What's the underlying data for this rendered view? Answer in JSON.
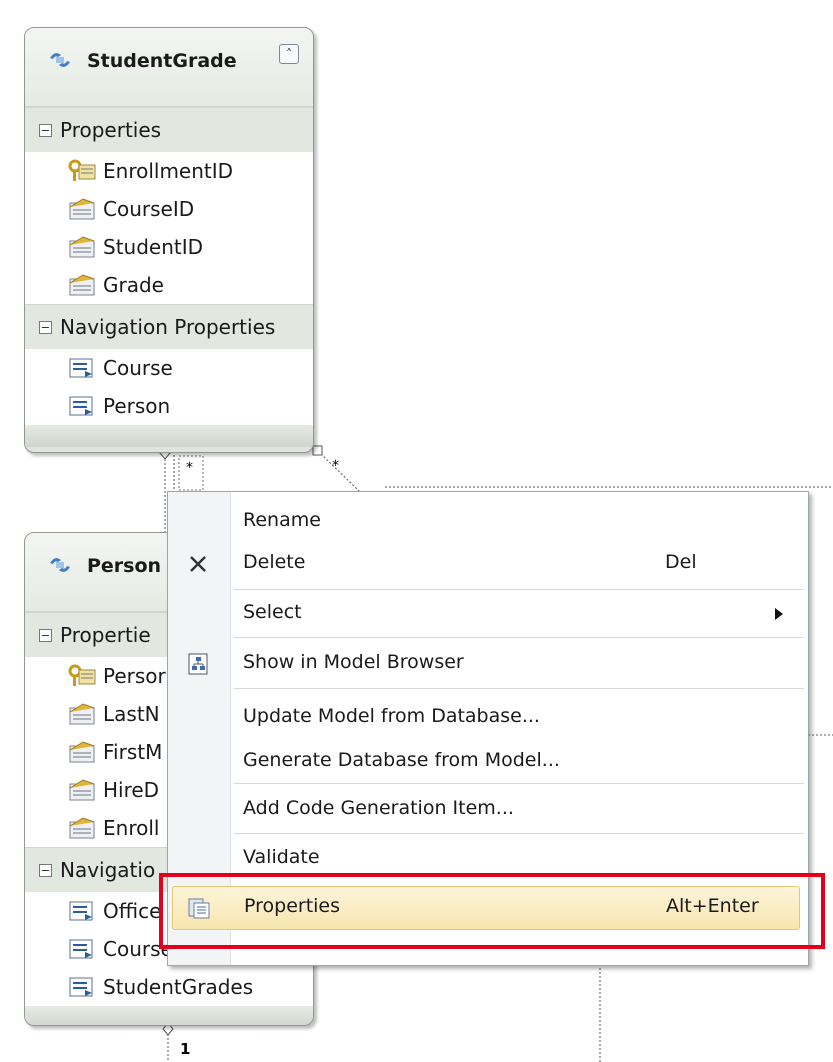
{
  "entities": {
    "student_grade": {
      "title": "StudentGrade",
      "sections": {
        "properties": "Properties",
        "navigation": "Navigation Properties"
      },
      "properties": [
        "EnrollmentID",
        "CourseID",
        "StudentID",
        "Grade"
      ],
      "navigation": [
        "Course",
        "Person"
      ]
    },
    "person": {
      "title": "Person",
      "sections": {
        "properties": "Propertie",
        "navigation": "Navigatio"
      },
      "properties": [
        "Persor",
        "LastN",
        "FirstM",
        "HireD",
        "Enroll"
      ],
      "navigation": [
        "Office",
        "Courses",
        "StudentGrades"
      ]
    }
  },
  "multiplicity": {
    "star_left": "*",
    "star_right": "*",
    "one": "1"
  },
  "context_menu": {
    "items": [
      {
        "label": "Rename",
        "shortcut": "",
        "icon": "none"
      },
      {
        "label": "Delete",
        "shortcut": "Del",
        "icon": "delete-x-icon"
      },
      {
        "label": "Select",
        "shortcut": "",
        "icon": "submenu-arrow-icon"
      },
      {
        "label": "Show in Model Browser",
        "shortcut": "",
        "icon": "model-browser-icon"
      },
      {
        "label": "Update Model from Database...",
        "shortcut": "",
        "icon": "none"
      },
      {
        "label": "Generate Database from Model...",
        "shortcut": "",
        "icon": "none"
      },
      {
        "label": "Add Code Generation Item...",
        "shortcut": "",
        "icon": "none"
      },
      {
        "label": "Validate",
        "shortcut": "",
        "icon": "none"
      },
      {
        "label": "Properties",
        "shortcut": "Alt+Enter",
        "icon": "properties-icon"
      }
    ],
    "highlighted": "Properties",
    "highlight_color": "#f8e6b0",
    "annotation_color": "#e4001c"
  }
}
